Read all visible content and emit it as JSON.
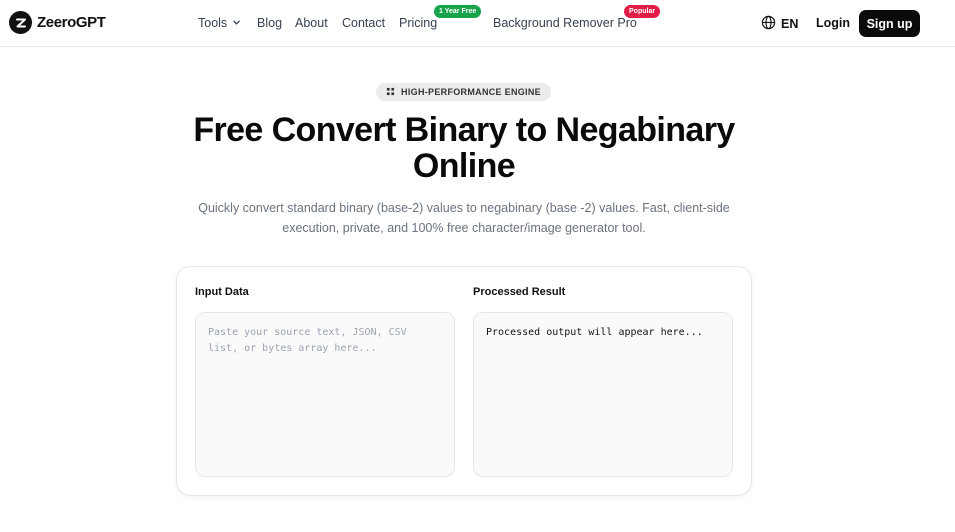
{
  "header": {
    "logo_text": "ZeeroGPT",
    "nav": {
      "tools": "Tools",
      "blog": "Blog",
      "about": "About",
      "contact": "Contact",
      "pricing": "Pricing",
      "pricing_badge": "1 Year Free",
      "bg_remover": "Background Remover Pro",
      "bg_remover_badge": "Popular"
    },
    "language": "EN",
    "login": "Login",
    "signup": "Sign up"
  },
  "hero": {
    "pill": "HIGH-PERFORMANCE ENGINE",
    "title": "Free Convert Binary to Negabinary Online",
    "subtitle": "Quickly convert standard binary (base-2) values to negabinary (base -2) values. Fast, client-side execution, private, and 100% free character/image generator tool."
  },
  "tool": {
    "input_label": "Input Data",
    "input_placeholder": "Paste your source text, JSON, CSV list, or bytes array here...",
    "input_value": "",
    "output_label": "Processed Result",
    "output_value": "Processed output will appear here..."
  },
  "colors": {
    "primary": "#0b0b0b",
    "badge_green": "#16a34a",
    "badge_red": "#e11d48",
    "muted_text": "#6b7280"
  },
  "icons": [
    "zeero-logo-icon",
    "chevron-down-icon",
    "globe-icon",
    "engine-icon"
  ]
}
